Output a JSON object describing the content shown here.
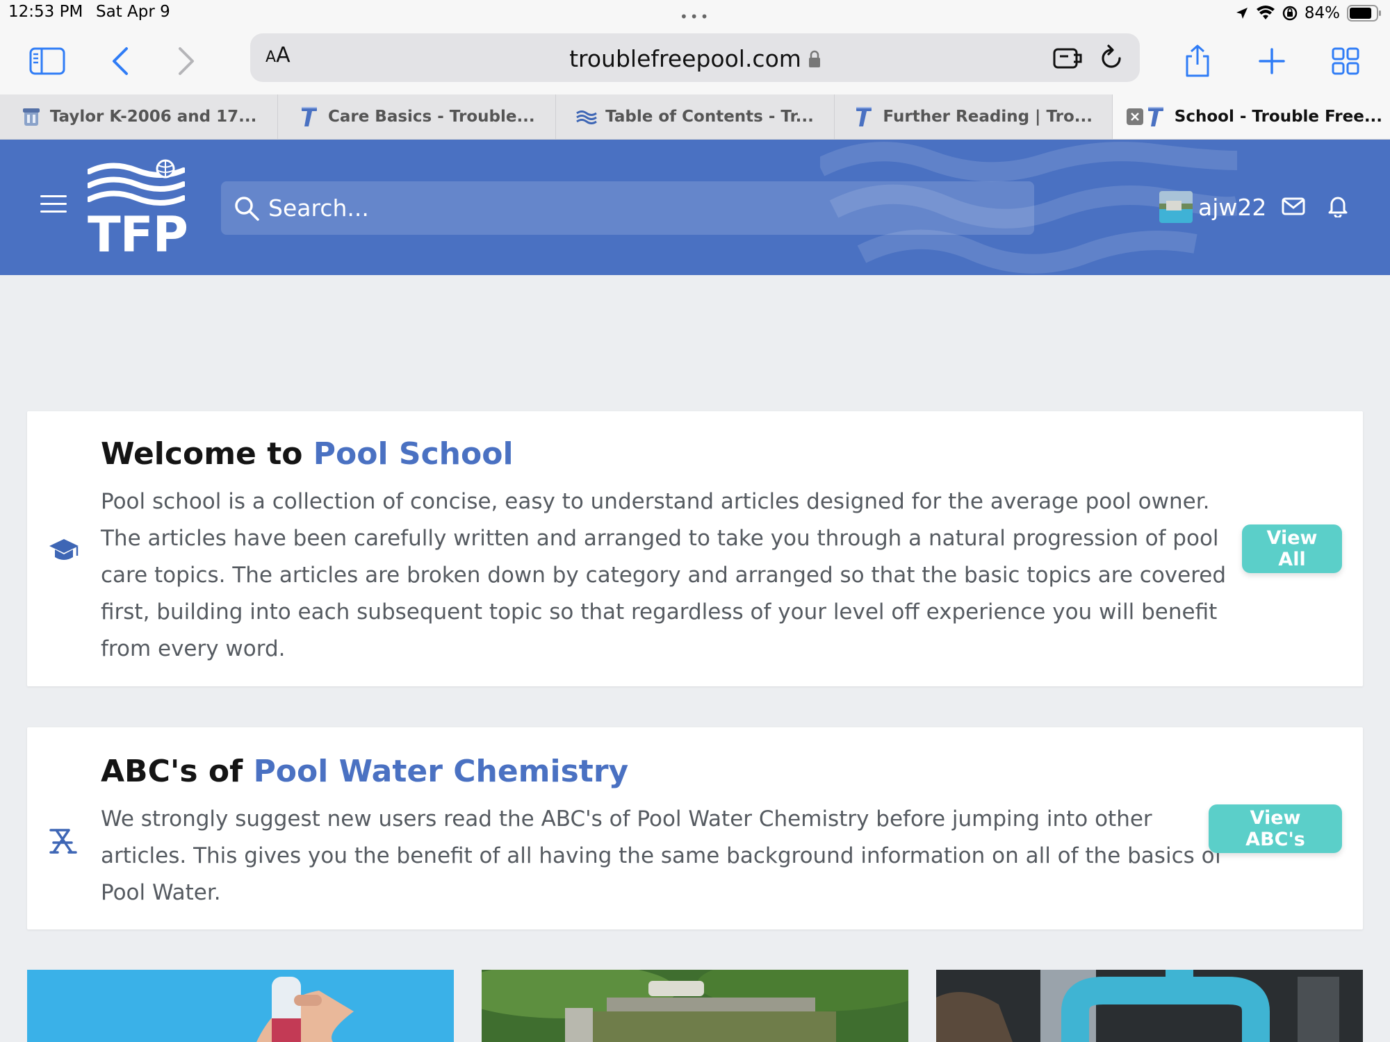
{
  "status_bar": {
    "time": "12:53 PM",
    "date": "Sat Apr 9",
    "battery_percent": "84%",
    "battery_level": 0.84,
    "icons": [
      "location-icon",
      "wifi-icon",
      "orientation-lock-icon",
      "battery-icon"
    ]
  },
  "browser": {
    "text_size_button": "AA",
    "url": "troublefreepool.com",
    "tabs": [
      {
        "label": "Taylor K-2006 and 17...",
        "favicon": "test-kit-favicon",
        "active": false
      },
      {
        "label": "Care Basics - Trouble...",
        "favicon": "tfp-favicon",
        "active": false
      },
      {
        "label": "Table of Contents - Tr...",
        "favicon": "waves-favicon",
        "active": false
      },
      {
        "label": "Further Reading | Tro...",
        "favicon": "tfp-favicon",
        "active": false
      },
      {
        "label": "School - Trouble Free...",
        "favicon": "tfp-favicon",
        "active": true
      }
    ]
  },
  "site_header": {
    "logo_text": "TFP",
    "search_placeholder": "Search...",
    "username": "ajw22",
    "brand_color": "#4a71c2"
  },
  "cards": [
    {
      "title_prefix": "Welcome to ",
      "title_accent": "Pool School",
      "body": "Pool school is a collection of concise, easy to understand articles designed for the average pool owner. The articles have been carefully written and arranged to take you through a natural progression of pool care topics. The articles are broken down by category and arranged so that the basic topics are covered first, building into each subsequent topic so that regardless of your level off experience you will benefit from every word.",
      "button_label": "View All",
      "icon": "graduation-cap-icon"
    },
    {
      "title_prefix": "ABC's of ",
      "title_accent": "Pool Water Chemistry",
      "body": "We strongly suggest new users read the ABC's of Pool Water Chemistry before jumping into other articles. This gives you the benefit of all having the same background information on all of the basics of Pool Water.",
      "button_label": "View ABC's",
      "icon": "lounge-chair-icon"
    }
  ],
  "accent_button_color": "#5bcfc9"
}
